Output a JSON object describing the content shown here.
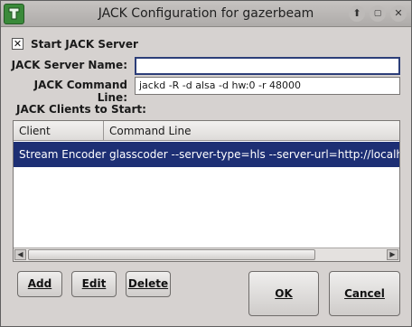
{
  "window": {
    "title": "JACK Configuration for gazerbeam"
  },
  "titlebar_buttons": {
    "up": "⬆",
    "maximize": "▢",
    "close": "✕"
  },
  "start_server": {
    "checked": true,
    "label": "Start JACK Server"
  },
  "fields": {
    "server_name_label": "JACK Server Name:",
    "server_name_value": "",
    "command_line_label": "JACK Command Line:",
    "command_line_value": "jackd -R -d alsa -d hw:0 -r 48000"
  },
  "clients": {
    "section_label": "JACK Clients to Start:",
    "columns": [
      "Client",
      "Command Line"
    ],
    "rows": [
      {
        "client": "Stream Encoder",
        "command": "glasscoder --server-type=hls --server-url=http://localhost/hls"
      }
    ]
  },
  "buttons": {
    "add": "Add",
    "edit": "Edit",
    "delete": "Delete",
    "ok": "OK",
    "cancel": "Cancel"
  }
}
